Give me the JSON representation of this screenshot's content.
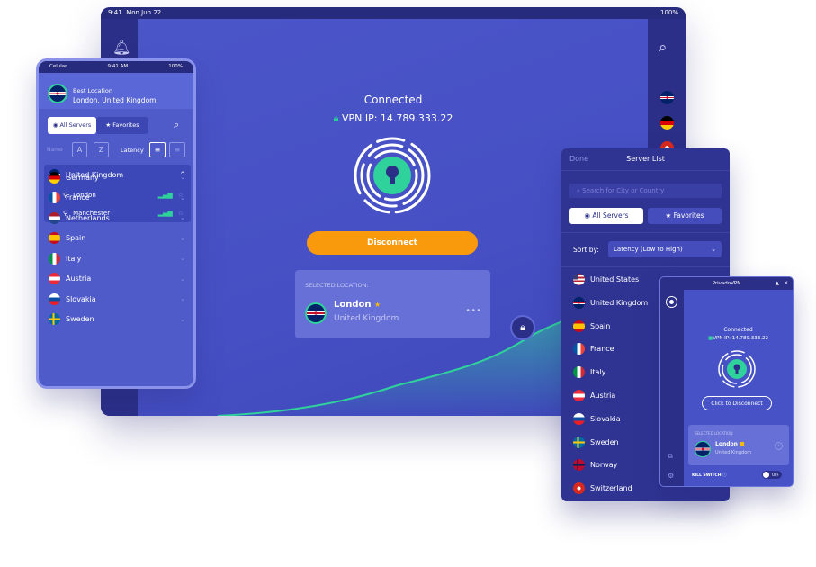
{
  "colors": {
    "accent": "#f89a0c",
    "connected": "#2fd29a",
    "primary": "#4b56c9",
    "dark": "#2b2f88"
  },
  "tablet": {
    "time": "9:41",
    "date": "Mon Jun 22",
    "battery": "100%",
    "status": "Connected",
    "vpn_ip": "VPN IP: 14.789.333.22",
    "disconnect": "Disconnect",
    "selected_label": "SELECTED LOCATION:",
    "city": "London",
    "country": "United Kingdom",
    "side_flags": [
      "uk",
      "de",
      "ch"
    ],
    "icons": [
      "bell-icon",
      "search-icon",
      "lock-icon",
      "more-icon"
    ]
  },
  "phone": {
    "carrier": "Celular",
    "time": "9:41 AM",
    "battery": "100%",
    "best_label": "Best Location",
    "best_value": "London, United Kingdom",
    "tabs": [
      "All Servers",
      "Favorites"
    ],
    "sort_name": "Name",
    "sort_latency": "Latency",
    "expanded": {
      "name": "United Kingdom",
      "flag": "uk",
      "cities": [
        "London",
        "Manchester"
      ]
    },
    "countries": [
      {
        "name": "Germany",
        "flag": "de"
      },
      {
        "name": "France",
        "flag": "fr"
      },
      {
        "name": "Netherlands",
        "flag": "nl"
      },
      {
        "name": "Spain",
        "flag": "es"
      },
      {
        "name": "Italy",
        "flag": "it"
      },
      {
        "name": "Austria",
        "flag": "at"
      },
      {
        "name": "Slovakia",
        "flag": "sk"
      },
      {
        "name": "Sweden",
        "flag": "se"
      }
    ]
  },
  "server_list": {
    "done": "Done",
    "title": "Server List",
    "search_placeholder": "Search for City or Country",
    "tabs": [
      "All Servers",
      "Favorites"
    ],
    "sort_label": "Sort by:",
    "sort_value": "Latency (Low to High)",
    "countries": [
      {
        "name": "United States",
        "flag": "us"
      },
      {
        "name": "United Kingdom",
        "flag": "uk"
      },
      {
        "name": "Spain",
        "flag": "es"
      },
      {
        "name": "France",
        "flag": "fr"
      },
      {
        "name": "Italy",
        "flag": "it"
      },
      {
        "name": "Austria",
        "flag": "at"
      },
      {
        "name": "Slovakia",
        "flag": "sk"
      },
      {
        "name": "Sweden",
        "flag": "se"
      },
      {
        "name": "Norway",
        "flag": "no"
      },
      {
        "name": "Switzerland",
        "flag": "ch"
      }
    ]
  },
  "desktop": {
    "title": "PrivadoVPN",
    "status": "Connected",
    "vpn_ip": "VPN IP: 14.789.333.22",
    "disconnect": "Click to Disconnect",
    "selected_label": "SELECTED LOCATION:",
    "city": "London",
    "country": "United Kingdom",
    "kill_switch": "KILL SWITCH",
    "toggle": "OFF"
  }
}
